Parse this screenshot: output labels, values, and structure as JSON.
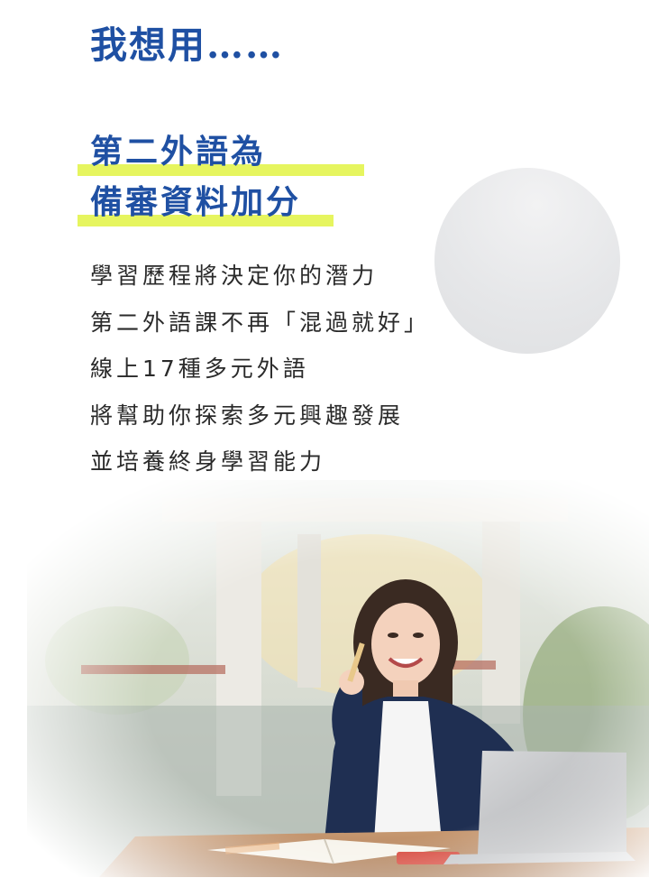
{
  "heading": "我想用……",
  "subheading": {
    "line1": "第二外語為",
    "line2": "備審資料加分"
  },
  "body_lines": [
    "學習歷程將決定你的潛力",
    "第二外語課不再「混過就好」",
    "線上17種多元外語",
    "將幫助你探索多元興趣發展",
    "並培養終身學習能力"
  ],
  "colors": {
    "heading_blue": "#1f50a3",
    "highlight_yellow": "#e6f55f",
    "body_text": "#2a2a2a",
    "circle_gray": "#e6e7e9"
  },
  "photo": {
    "icon": "student-with-laptop-photo"
  }
}
